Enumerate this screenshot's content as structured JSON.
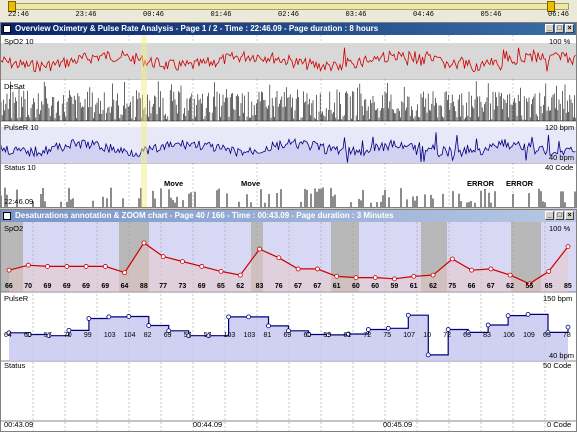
{
  "timeline": {
    "ticks": [
      "22:46",
      "23:46",
      "00:46",
      "01:46",
      "02:46",
      "03:46",
      "04:46",
      "05:46",
      "06:46"
    ]
  },
  "overview": {
    "title": "Overview Oximetry & Pulse Rate Analysis - Page 1 / 2 - Time : 22:46.09 - Page duration : 8 hours",
    "spo2_label": "SpO2 10",
    "spo2_max": "100 %",
    "desat_label": "DeSat",
    "pulse_label": "PulseR 10",
    "pulse_max": "120 bpm",
    "pulse_min": "40 bpm",
    "status_label": "Status 10",
    "status_max": "40 Code",
    "event_labels": [
      "Move",
      "Move",
      "ERROR",
      "ERROR"
    ],
    "start_time": "22:46.09"
  },
  "zoom": {
    "title": "Desaturations annotation & ZOOM chart - Page 40 / 166 - Time : 00:43.09 - Page duration : 3 Minutes",
    "spo2_label": "SpO2",
    "spo2_max": "100 %",
    "pulse_label": "PulseR",
    "pulse_max": "150 bpm",
    "pulse_min": "40 bpm",
    "status_label": "Status",
    "status_max": "50 Code",
    "status_min": "0 Code",
    "time_labels": [
      "00:43.09",
      "00:44.09",
      "00:45.09"
    ],
    "spo2_values": [
      "66",
      "70",
      "69",
      "69",
      "69",
      "69",
      "64",
      "88",
      "77",
      "73",
      "69",
      "65",
      "62",
      "83",
      "76",
      "67",
      "67",
      "61",
      "60",
      "60",
      "59",
      "61",
      "62",
      "75",
      "66",
      "67",
      "62",
      "55",
      "65",
      "85"
    ],
    "pulse_values": [
      "64",
      "60",
      "57",
      "70",
      "99",
      "103",
      "104",
      "82",
      "69",
      "57",
      "57",
      "103",
      "103",
      "81",
      "69",
      "60",
      "59",
      "61",
      "72",
      "75",
      "107",
      "10",
      "72",
      "65",
      "83",
      "106",
      "109",
      "65",
      "78"
    ]
  },
  "colors": {
    "title_bg": "#0a246a",
    "title_bg2": "#3a6ea5",
    "spo2": "#cc0000",
    "pulse": "#000080",
    "fill": "#c8c8f0",
    "desat": "#000000"
  }
}
